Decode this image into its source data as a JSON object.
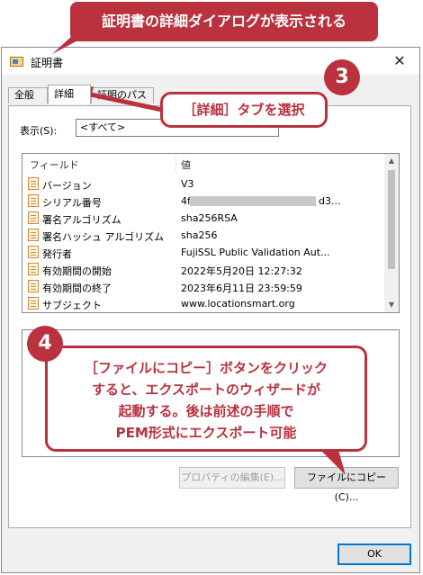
{
  "window": {
    "title": "証明書",
    "close": "✕"
  },
  "tabs": [
    {
      "label": "全般"
    },
    {
      "label": "詳細"
    },
    {
      "label": "証明のパス"
    }
  ],
  "show": {
    "label": "表示(S):",
    "value": "<すべて>"
  },
  "list": {
    "col_field": "フィールド",
    "col_value": "値",
    "rows": [
      {
        "field": "バージョン",
        "value": "V3"
      },
      {
        "field": "シリアル番号",
        "value": "4f",
        "value_tail": "d3..."
      },
      {
        "field": "署名アルゴリズム",
        "value": "sha256RSA"
      },
      {
        "field": "署名ハッシュ アルゴリズム",
        "value": "sha256"
      },
      {
        "field": "発行者",
        "value": "FujiSSL Public Validation Aut..."
      },
      {
        "field": "有効期間の開始",
        "value": "2022年5月20日 12:27:32"
      },
      {
        "field": "有効期間の終了",
        "value": "2023年6月11日 23:59:59"
      },
      {
        "field": "サブジェクト",
        "value": "www.locationsmart.org"
      }
    ]
  },
  "buttons": {
    "properties": "プロパティの編集(E)...",
    "copy_to_file": "ファイルにコピー(C)...",
    "ok": "OK"
  },
  "annotations": {
    "title": "証明書の詳細ダイアログが表示される",
    "step3_num": "3",
    "step3_text": "［詳細］タブを選択",
    "step4_num": "4",
    "step4_line1": "［ファイルにコピー］ボタンをクリック",
    "step4_line2": "すると、エクスポートのウィザードが",
    "step4_line3": "起動する。後は前述の手順で",
    "step4_line4": "PEM形式にエクスポート可能"
  },
  "colors": {
    "annotation_red": "#b9323e",
    "ok_border": "#0078d7"
  }
}
